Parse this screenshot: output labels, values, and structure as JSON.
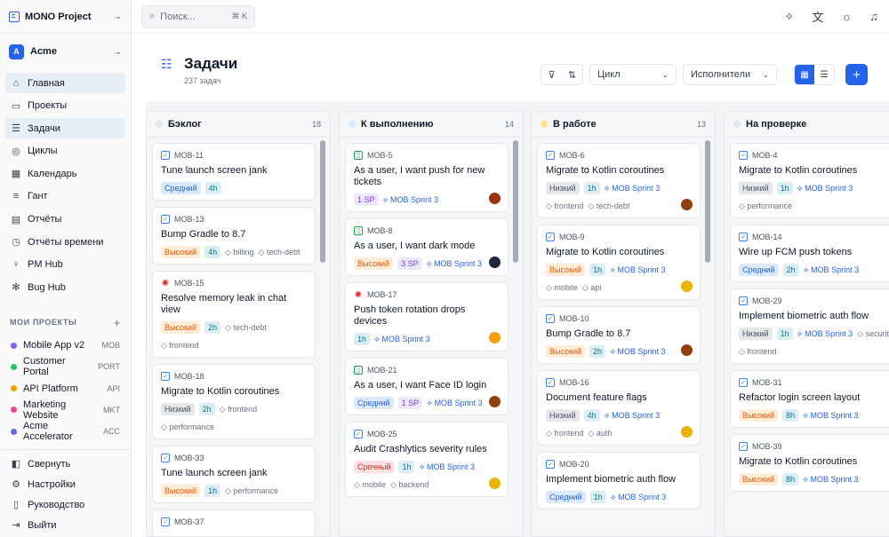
{
  "sidebar": {
    "project_name": "MONO Project",
    "workspace_initial": "A",
    "workspace_name": "Acme",
    "nav": [
      {
        "label": "Главная",
        "icon": "home-icon",
        "glyph": "⌂",
        "active": true
      },
      {
        "label": "Проекты",
        "icon": "folder-icon",
        "glyph": "▭",
        "active": false
      },
      {
        "label": "Задачи",
        "icon": "tasks-icon",
        "glyph": "☰",
        "active": true
      },
      {
        "label": "Циклы",
        "icon": "cycle-icon",
        "glyph": "◎",
        "active": false
      },
      {
        "label": "Календарь",
        "icon": "calendar-icon",
        "glyph": "▦",
        "active": false
      },
      {
        "label": "Гант",
        "icon": "gantt-icon",
        "glyph": "≡",
        "active": false
      },
      {
        "label": "Отчёты",
        "icon": "report-icon",
        "glyph": "▤",
        "active": false
      },
      {
        "label": "Отчёты времени",
        "icon": "clock-icon",
        "glyph": "◷",
        "active": false
      },
      {
        "label": "PM Hub",
        "icon": "bulb-icon",
        "glyph": "♀",
        "active": false
      },
      {
        "label": "Bug Hub",
        "icon": "bug-icon",
        "glyph": "✻",
        "active": false
      }
    ],
    "projects_header": "МОИ ПРОЕКТЫ",
    "projects": [
      {
        "name": "Mobile App v2",
        "code": "MOB",
        "color": "#8b5cf6"
      },
      {
        "name": "Customer Portal",
        "code": "PORT",
        "color": "#22c55e"
      },
      {
        "name": "API Platform",
        "code": "API",
        "color": "#f59e0b"
      },
      {
        "name": "Marketing Website",
        "code": "MKT",
        "color": "#ec4899"
      },
      {
        "name": "Acme Accelerator",
        "code": "ACC",
        "color": "#6366f1"
      }
    ],
    "bottom": [
      {
        "label": "Свернуть",
        "icon": "collapse-icon",
        "glyph": "◧"
      },
      {
        "label": "Настройки",
        "icon": "gear-icon",
        "glyph": "⚙"
      },
      {
        "label": "Руководство",
        "icon": "book-icon",
        "glyph": "▯"
      },
      {
        "label": "Выйти",
        "icon": "logout-icon",
        "glyph": "⇥"
      }
    ]
  },
  "topbar": {
    "search_placeholder": "Поиск...",
    "search_kbd": "⌘ K"
  },
  "header": {
    "title": "Задачи",
    "subtitle": "237 задач",
    "cycle_select": "Цикл",
    "assignee_select": "Исполнители"
  },
  "columns": [
    {
      "name": "Бэклог",
      "count": "18",
      "dot": "#e5e7eb",
      "cards": [
        {
          "id": "MOB-11",
          "type": "task",
          "title": "Tune launch screen jank",
          "tags": [
            {
              "t": "Средний",
              "c": "t-sred"
            },
            {
              "t": "4h",
              "c": "t-est"
            }
          ]
        },
        {
          "id": "MOB-13",
          "type": "task",
          "title": "Bump Gradle to 8.7",
          "tags": [
            {
              "t": "Высокий",
              "c": "t-high"
            },
            {
              "t": "4h",
              "c": "t-est"
            },
            {
              "t": "billing",
              "c": "t-lbl"
            },
            {
              "t": "tech-debt",
              "c": "t-lbl"
            }
          ]
        },
        {
          "id": "MOB-15",
          "type": "bug",
          "title": "Resolve memory leak in chat view",
          "tags": [
            {
              "t": "Высокий",
              "c": "t-high"
            },
            {
              "t": "2h",
              "c": "t-est"
            },
            {
              "t": "tech-debt",
              "c": "t-lbl"
            },
            {
              "t": "frontend",
              "c": "t-lbl"
            }
          ]
        },
        {
          "id": "MOB-18",
          "type": "task",
          "title": "Migrate to Kotlin coroutines",
          "tags": [
            {
              "t": "Низкий",
              "c": "t-low"
            },
            {
              "t": "2h",
              "c": "t-est"
            },
            {
              "t": "frontend",
              "c": "t-lbl"
            },
            {
              "t": "performance",
              "c": "t-lbl"
            }
          ]
        },
        {
          "id": "MOB-33",
          "type": "task",
          "title": "Tune launch screen jank",
          "tags": [
            {
              "t": "Высокий",
              "c": "t-high"
            },
            {
              "t": "1h",
              "c": "t-est"
            },
            {
              "t": "performance",
              "c": "t-lbl"
            }
          ]
        },
        {
          "id": "MOB-37",
          "type": "task",
          "title": "",
          "tags": []
        }
      ]
    },
    {
      "name": "К выполнению",
      "count": "14",
      "dot": "#dbeafe",
      "cards": [
        {
          "id": "MOB-5",
          "type": "story",
          "title": "As a user, I want push for new tickets",
          "tags": [
            {
              "t": "1 SP",
              "c": "t-sp"
            },
            {
              "t": "MOB Sprint 3",
              "c": "t-spr"
            }
          ],
          "avatar": "#9a3412"
        },
        {
          "id": "MOB-8",
          "type": "story",
          "title": "As a user, I want dark mode",
          "tags": [
            {
              "t": "Высокий",
              "c": "t-high"
            },
            {
              "t": "3 SP",
              "c": "t-sp"
            },
            {
              "t": "MOB Sprint 3",
              "c": "t-spr"
            }
          ],
          "avatar": "#1e293b"
        },
        {
          "id": "MOB-17",
          "type": "bug",
          "title": "Push token rotation drops devices",
          "tags": [
            {
              "t": "1h",
              "c": "t-est"
            },
            {
              "t": "MOB Sprint 3",
              "c": "t-spr"
            }
          ],
          "avatar": "#f59e0b"
        },
        {
          "id": "MOB-21",
          "type": "story",
          "title": "As a user, I want Face ID login",
          "tags": [
            {
              "t": "Средний",
              "c": "t-sred"
            },
            {
              "t": "1 SP",
              "c": "t-sp"
            },
            {
              "t": "MOB Sprint 3",
              "c": "t-spr"
            }
          ],
          "avatar": "#92400e"
        },
        {
          "id": "MOB-25",
          "type": "task",
          "title": "Audit Crashlytics severity rules",
          "tags": [
            {
              "t": "Срочный",
              "c": "t-urg"
            },
            {
              "t": "1h",
              "c": "t-est"
            },
            {
              "t": "MOB Sprint 3",
              "c": "t-spr"
            },
            {
              "t": "mobile",
              "c": "t-lbl"
            },
            {
              "t": "backend",
              "c": "t-lbl"
            }
          ],
          "avatar": "#eab308"
        }
      ]
    },
    {
      "name": "В работе",
      "count": "13",
      "dot": "#fde68a",
      "cards": [
        {
          "id": "MOB-6",
          "type": "task",
          "title": "Migrate to Kotlin coroutines",
          "tags": [
            {
              "t": "Низкий",
              "c": "t-low"
            },
            {
              "t": "1h",
              "c": "t-est"
            },
            {
              "t": "MOB Sprint 3",
              "c": "t-spr"
            },
            {
              "t": "frontend",
              "c": "t-lbl"
            },
            {
              "t": "tech-debt",
              "c": "t-lbl"
            }
          ],
          "avatar": "#92400e"
        },
        {
          "id": "MOB-9",
          "type": "task",
          "title": "Migrate to Kotlin coroutines",
          "tags": [
            {
              "t": "Высокий",
              "c": "t-high"
            },
            {
              "t": "1h",
              "c": "t-est"
            },
            {
              "t": "MOB Sprint 3",
              "c": "t-spr"
            },
            {
              "t": "mobile",
              "c": "t-lbl"
            },
            {
              "t": "api",
              "c": "t-lbl"
            }
          ],
          "avatar": "#eab308"
        },
        {
          "id": "MOB-10",
          "type": "task",
          "title": "Bump Gradle to 8.7",
          "tags": [
            {
              "t": "Высокий",
              "c": "t-high"
            },
            {
              "t": "2h",
              "c": "t-est"
            },
            {
              "t": "MOB Sprint 3",
              "c": "t-spr"
            }
          ],
          "avatar": "#92400e"
        },
        {
          "id": "MOB-16",
          "type": "task",
          "title": "Document feature flags",
          "tags": [
            {
              "t": "Низкий",
              "c": "t-low"
            },
            {
              "t": "4h",
              "c": "t-est"
            },
            {
              "t": "MOB Sprint 3",
              "c": "t-spr"
            },
            {
              "t": "frontend",
              "c": "t-lbl"
            },
            {
              "t": "auth",
              "c": "t-lbl"
            }
          ],
          "avatar": "#eab308"
        },
        {
          "id": "MOB-20",
          "type": "task",
          "title": "Implement biometric auth flow",
          "tags": [
            {
              "t": "Средний",
              "c": "t-sred"
            },
            {
              "t": "1h",
              "c": "t-est"
            },
            {
              "t": "MOB Sprint 3",
              "c": "t-spr"
            }
          ]
        }
      ]
    },
    {
      "name": "На проверке",
      "count": "",
      "dot": "#e5e7eb",
      "cards": [
        {
          "id": "MOB-4",
          "type": "task",
          "title": "Migrate to Kotlin coroutines",
          "tags": [
            {
              "t": "Низкий",
              "c": "t-low"
            },
            {
              "t": "1h",
              "c": "t-est"
            },
            {
              "t": "MOB Sprint 3",
              "c": "t-spr"
            },
            {
              "t": "performance",
              "c": "t-lbl"
            }
          ]
        },
        {
          "id": "MOB-14",
          "type": "task",
          "title": "Wire up FCM push tokens",
          "tags": [
            {
              "t": "Средний",
              "c": "t-sred"
            },
            {
              "t": "2h",
              "c": "t-est"
            },
            {
              "t": "MOB Sprint 3",
              "c": "t-spr"
            }
          ]
        },
        {
          "id": "MOB-29",
          "type": "task",
          "title": "Implement biometric auth flow",
          "tags": [
            {
              "t": "Низкий",
              "c": "t-low"
            },
            {
              "t": "1h",
              "c": "t-est"
            },
            {
              "t": "MOB Sprint 3",
              "c": "t-spr"
            },
            {
              "t": "security",
              "c": "t-lbl"
            },
            {
              "t": "frontend",
              "c": "t-lbl"
            }
          ]
        },
        {
          "id": "MOB-31",
          "type": "task",
          "title": "Refactor login screen layout",
          "tags": [
            {
              "t": "Высокий",
              "c": "t-high"
            },
            {
              "t": "8h",
              "c": "t-est"
            },
            {
              "t": "MOB Sprint 3",
              "c": "t-spr"
            }
          ]
        },
        {
          "id": "MOB-39",
          "type": "task",
          "title": "Migrate to Kotlin coroutines",
          "tags": [
            {
              "t": "Высокий",
              "c": "t-high"
            },
            {
              "t": "8h",
              "c": "t-est"
            },
            {
              "t": "MOB Sprint 3",
              "c": "t-spr"
            }
          ]
        }
      ]
    }
  ]
}
